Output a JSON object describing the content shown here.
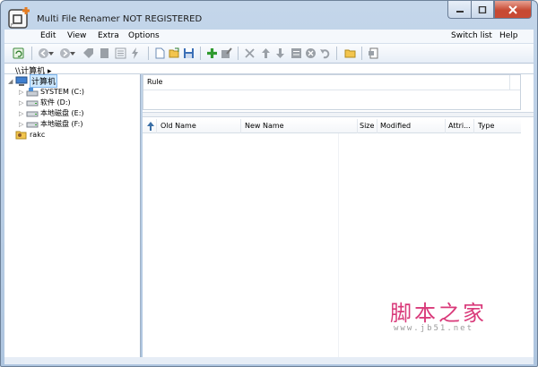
{
  "window": {
    "title": "Multi File Renamer NOT REGISTERED"
  },
  "menu": {
    "left": [
      "Edit",
      "View",
      "Extra",
      "Options"
    ],
    "right": [
      "Switch list",
      "Help"
    ]
  },
  "address": {
    "path": "\\\\计算机"
  },
  "tree": {
    "items": [
      {
        "label": "计算机",
        "icon": "computer-icon",
        "selected": true
      },
      {
        "label": "SYSTEM (C:)",
        "icon": "system-drive-icon"
      },
      {
        "label": "软件 (D:)",
        "icon": "drive-icon"
      },
      {
        "label": "本地磁盘 (E:)",
        "icon": "drive-icon"
      },
      {
        "label": "本地磁盘 (F:)",
        "icon": "drive-icon"
      },
      {
        "label": "rakc",
        "icon": "user-folder-icon"
      }
    ]
  },
  "rules": {
    "header": "Rule"
  },
  "files": {
    "columns": [
      "Old Name",
      "New Name",
      "Size",
      "Modified",
      "Attri...",
      "Type"
    ]
  },
  "watermark": {
    "chinese": "脚本之家",
    "url": "www.jb51.net"
  },
  "colors": {
    "accent": "#3a6ea5",
    "close_button": "#c74a33",
    "watermark": "#d93a7a"
  }
}
